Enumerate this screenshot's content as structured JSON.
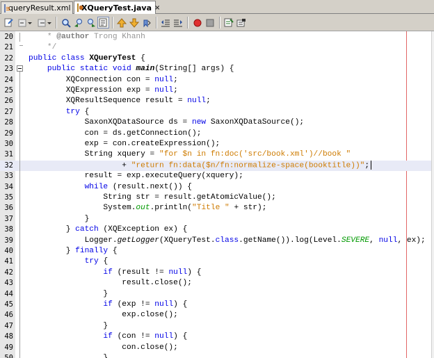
{
  "tabs": [
    {
      "label": "queryResult.xml",
      "icon": "xml-file-icon",
      "close": "×",
      "active": false
    },
    {
      "label": "XQueryTest.java",
      "icon": "java-file-icon",
      "close": "×",
      "active": true
    }
  ],
  "toolbar": {
    "buttons": [
      "last-edit-icon",
      "back-icon",
      "forward-icon",
      "find-icon",
      "find-previous-icon",
      "find-next-icon",
      "toggle-highlight-icon",
      "previous-bookmark-icon",
      "next-bookmark-icon",
      "toggle-bookmark-icon",
      "shift-left-icon",
      "shift-right-icon",
      "start-macro-icon",
      "stop-macro-icon",
      "comment-icon",
      "uncomment-icon"
    ]
  },
  "editor": {
    "current_line": 32,
    "lines": [
      {
        "n": "20",
        "tokens": [
          [
            "cm",
            "    * "
          ],
          [
            "cmb",
            "@author"
          ],
          [
            "cm",
            " Trong Khanh"
          ]
        ]
      },
      {
        "n": "21",
        "tokens": [
          [
            "cm",
            "    */"
          ]
        ]
      },
      {
        "n": "22",
        "tokens": [
          [
            "kw",
            "public"
          ],
          [
            "",
            ""
          ],
          [
            "",
            " "
          ],
          [
            "kw",
            "class"
          ],
          [
            "",
            " "
          ],
          [
            "b",
            "XQueryTest"
          ],
          [
            "",
            " {"
          ]
        ]
      },
      {
        "n": "23",
        "tokens": [
          [
            "",
            "    "
          ],
          [
            "kw",
            "public"
          ],
          [
            "",
            " "
          ],
          [
            "kw",
            "static"
          ],
          [
            "",
            " "
          ],
          [
            "kw",
            "void"
          ],
          [
            "",
            " "
          ],
          [
            "bi",
            "main"
          ],
          [
            "",
            "(String[] args) {"
          ]
        ]
      },
      {
        "n": "24",
        "tokens": [
          [
            "",
            "        XQConnection con = "
          ],
          [
            "kw",
            "null"
          ],
          [
            "",
            ";"
          ]
        ]
      },
      {
        "n": "25",
        "tokens": [
          [
            "",
            "        XQExpression exp = "
          ],
          [
            "kw",
            "null"
          ],
          [
            "",
            ";"
          ]
        ]
      },
      {
        "n": "26",
        "tokens": [
          [
            "",
            "        XQResultSequence result = "
          ],
          [
            "kw",
            "null"
          ],
          [
            "",
            ";"
          ]
        ]
      },
      {
        "n": "27",
        "tokens": [
          [
            "",
            "        "
          ],
          [
            "kw",
            "try"
          ],
          [
            "",
            " {"
          ]
        ]
      },
      {
        "n": "28",
        "tokens": [
          [
            "",
            "            SaxonXQDataSource ds = "
          ],
          [
            "kw",
            "new"
          ],
          [
            "",
            " SaxonXQDataSource();"
          ]
        ]
      },
      {
        "n": "29",
        "tokens": [
          [
            "",
            "            con = ds.getConnection();"
          ]
        ]
      },
      {
        "n": "30",
        "tokens": [
          [
            "",
            "            exp = con.createExpression();"
          ]
        ]
      },
      {
        "n": "31",
        "tokens": [
          [
            "",
            "            String xquery = "
          ],
          [
            "str",
            "\"for $n in fn:doc('src/book.xml')//book \""
          ]
        ]
      },
      {
        "n": "32",
        "tokens": [
          [
            "",
            "                    + "
          ],
          [
            "str",
            "\"return fn:data($n/fn:normalize-space(booktitle))\""
          ],
          [
            "",
            ";"
          ]
        ]
      },
      {
        "n": "33",
        "tokens": [
          [
            "",
            "            result = exp.executeQuery(xquery);"
          ]
        ]
      },
      {
        "n": "34",
        "tokens": [
          [
            "",
            "            "
          ],
          [
            "kw",
            "while"
          ],
          [
            "",
            " (result.next()) {"
          ]
        ]
      },
      {
        "n": "35",
        "tokens": [
          [
            "",
            "                String str = result.getAtomicValue();"
          ]
        ]
      },
      {
        "n": "36",
        "tokens": [
          [
            "",
            "                System."
          ],
          [
            "fld",
            "out"
          ],
          [
            "",
            ".println("
          ],
          [
            "str",
            "\"Title \""
          ],
          [
            "",
            " + str);"
          ]
        ]
      },
      {
        "n": "37",
        "tokens": [
          [
            "",
            "            }"
          ]
        ]
      },
      {
        "n": "38",
        "tokens": [
          [
            "",
            "        } "
          ],
          [
            "kw",
            "catch"
          ],
          [
            "",
            " (XQException ex) {"
          ]
        ]
      },
      {
        "n": "39",
        "tokens": [
          [
            "",
            "            Logger."
          ],
          [
            "it",
            "getLogger"
          ],
          [
            "",
            "(XQueryTest."
          ],
          [
            "kw",
            "class"
          ],
          [
            "",
            ".getName()).log(Level."
          ],
          [
            "fld",
            "SEVERE"
          ],
          [
            "",
            ", "
          ],
          [
            "kw",
            "null"
          ],
          [
            "",
            ", ex);"
          ]
        ]
      },
      {
        "n": "40",
        "tokens": [
          [
            "",
            "        } "
          ],
          [
            "kw",
            "finally"
          ],
          [
            "",
            " {"
          ]
        ]
      },
      {
        "n": "41",
        "tokens": [
          [
            "",
            "            "
          ],
          [
            "kw",
            "try"
          ],
          [
            "",
            " {"
          ]
        ]
      },
      {
        "n": "42",
        "tokens": [
          [
            "",
            "                "
          ],
          [
            "kw",
            "if"
          ],
          [
            "",
            " (result != "
          ],
          [
            "kw",
            "null"
          ],
          [
            "",
            ") {"
          ]
        ]
      },
      {
        "n": "43",
        "tokens": [
          [
            "",
            "                    result.close();"
          ]
        ]
      },
      {
        "n": "44",
        "tokens": [
          [
            "",
            "                }"
          ]
        ]
      },
      {
        "n": "45",
        "tokens": [
          [
            "",
            "                "
          ],
          [
            "kw",
            "if"
          ],
          [
            "",
            " (exp != "
          ],
          [
            "kw",
            "null"
          ],
          [
            "",
            ") {"
          ]
        ]
      },
      {
        "n": "46",
        "tokens": [
          [
            "",
            "                    exp.close();"
          ]
        ]
      },
      {
        "n": "47",
        "tokens": [
          [
            "",
            "                }"
          ]
        ]
      },
      {
        "n": "48",
        "tokens": [
          [
            "",
            "                "
          ],
          [
            "kw",
            "if"
          ],
          [
            "",
            " (con != "
          ],
          [
            "kw",
            "null"
          ],
          [
            "",
            ") {"
          ]
        ]
      },
      {
        "n": "49",
        "tokens": [
          [
            "",
            "                    con.close();"
          ]
        ]
      },
      {
        "n": "50",
        "tokens": [
          [
            "",
            "                }"
          ]
        ]
      }
    ]
  }
}
